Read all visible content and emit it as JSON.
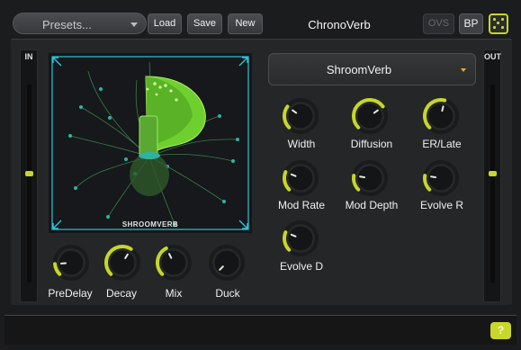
{
  "toolbar": {
    "presets_label": "Presets...",
    "load_label": "Load",
    "save_label": "Save",
    "new_label": "New",
    "title": "ChronoVerb",
    "ovs_label": "OVS",
    "bp_label": "BP"
  },
  "meters": {
    "in_label": "IN",
    "out_label": "OUT"
  },
  "visualizer": {
    "label": "SHROOMVERB"
  },
  "algorithm": {
    "selected": "ShroomVerb"
  },
  "knobs": {
    "predelay": {
      "label": "PreDelay",
      "value": 0.15
    },
    "decay": {
      "label": "Decay",
      "value": 0.62
    },
    "mix": {
      "label": "Mix",
      "value": 0.4
    },
    "duck": {
      "label": "Duck",
      "value": 0.0
    },
    "width": {
      "label": "Width",
      "value": 0.3
    },
    "diffusion": {
      "label": "Diffusion",
      "value": 0.7
    },
    "er_late": {
      "label": "ER/Late",
      "value": 0.55
    },
    "mod_rate": {
      "label": "Mod Rate",
      "value": 0.25
    },
    "mod_depth": {
      "label": "Mod Depth",
      "value": 0.2
    },
    "evolve_r": {
      "label": "Evolve R",
      "value": 0.2
    },
    "evolve_d": {
      "label": "Evolve D",
      "value": 0.25
    }
  },
  "help_label": "?",
  "colors": {
    "accent": "#c6d62a",
    "viz_frame": "#2ec4d8",
    "viz_green": "#7ddb2a"
  }
}
